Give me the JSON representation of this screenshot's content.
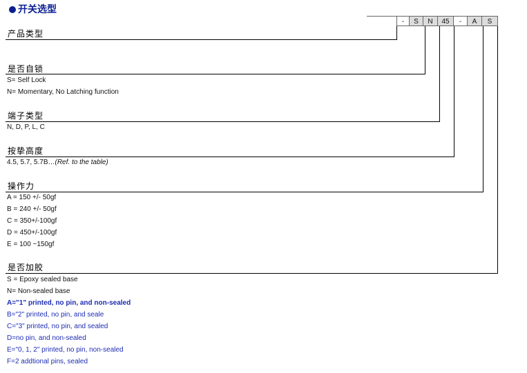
{
  "title": "开关选型",
  "part_code": {
    "prefix_sep": "-",
    "s": "S",
    "n": "N",
    "height": "45",
    "mid_sep": "-",
    "a": "A",
    "last_s": "S"
  },
  "product_type": {
    "label": "产品类型"
  },
  "self_lock": {
    "label": "是否自锁",
    "options": [
      "S= Self Lock",
      "N= Momentary, No Latching function"
    ]
  },
  "terminal_type": {
    "label": "端子类型",
    "options": [
      "N, D, P, L, C"
    ]
  },
  "button_height": {
    "label": "按挚高度",
    "value": "4.5, 5.7, 5.7B…",
    "note": "(Ref. to the table)"
  },
  "operating_force": {
    "label": "操作力",
    "options": [
      "A = 150 +/- 50gf",
      "B = 240 +/- 50gf",
      "C = 350+/-100gf",
      "D = 450+/-100gf",
      "E = 100 ~150gf"
    ]
  },
  "glue": {
    "label": "是否加胶",
    "options": [
      "S = Epoxy sealed base",
      "N= Non-sealed base"
    ],
    "print_options": [
      "A=\"1\" printed, no pin, and non-sealed",
      "B=\"2\" printed, no pin, and seale",
      "C=\"3\" printed, no pin, and sealed",
      "D=no pin, and non-sealed",
      "E=\"0, 1, 2\" printed, no pin,  non-sealed",
      "F=2 addtional pins, sealed"
    ]
  },
  "colors": {
    "title": "#0b1f8f",
    "blue_text": "#1d2db3",
    "code_cell_bg": "#dcdcdc"
  }
}
